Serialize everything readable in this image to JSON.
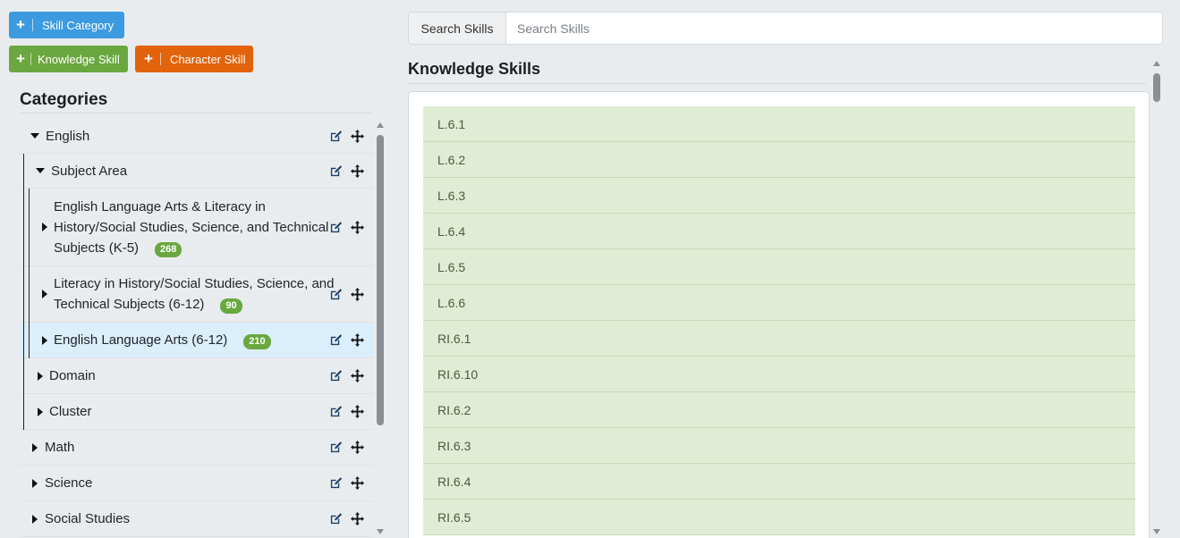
{
  "buttons": {
    "skill_category": "Skill Category",
    "knowledge_skill": "Knowledge Skill",
    "character_skill": "Character Skill",
    "plus": "+"
  },
  "categories": {
    "title": "Categories",
    "nodes": [
      {
        "label": "English",
        "expanded": true
      },
      {
        "label": "Subject Area",
        "expanded": true
      },
      {
        "label_lines": [
          "English Language Arts & Literacy in",
          "History/Social Studies, Science, and Technical",
          "Subjects (K-5)"
        ],
        "count": "268"
      },
      {
        "label_lines": [
          "Literacy in History/Social Studies, Science, and",
          "Technical Subjects (6-12)"
        ],
        "count": "90"
      },
      {
        "label": "English Language Arts (6-12)",
        "count": "210",
        "selected": true
      },
      {
        "label": "Domain"
      },
      {
        "label": "Cluster"
      },
      {
        "label": "Math"
      },
      {
        "label": "Science"
      },
      {
        "label": "Social Studies"
      }
    ]
  },
  "search": {
    "addon_label": "Search Skills",
    "placeholder": "Search Skills",
    "value": ""
  },
  "knowledge_skills": {
    "title": "Knowledge Skills",
    "items": [
      "L.6.1",
      "L.6.2",
      "L.6.3",
      "L.6.4",
      "L.6.5",
      "L.6.6",
      "RI.6.1",
      "RI.6.10",
      "RI.6.2",
      "RI.6.3",
      "RI.6.4",
      "RI.6.5"
    ]
  },
  "colors": {
    "primary": "#3c9be0",
    "success": "#6aa83f",
    "warning": "#e2630c",
    "selected_row": "#dbeefb",
    "skill_row": "#e0ecd3",
    "icon": "#1d3f66"
  }
}
